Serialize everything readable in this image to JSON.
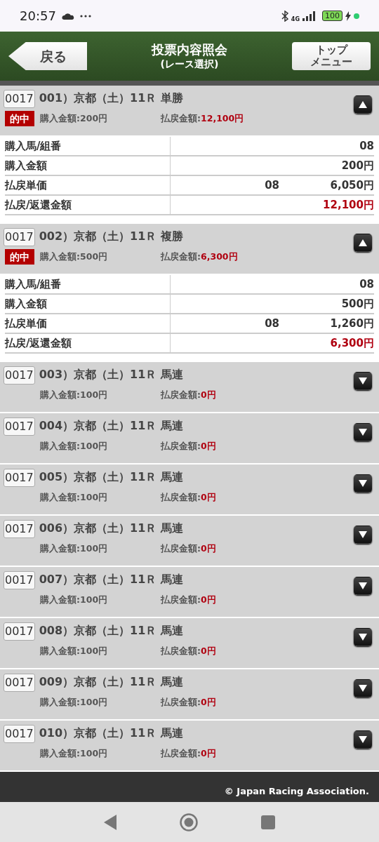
{
  "status_bar": {
    "time": "20:57",
    "network": "4G",
    "battery": "100"
  },
  "header": {
    "back_button": "戻る",
    "title": "投票内容照会",
    "subtitle": "(レース選択)",
    "top_button_lines": [
      "トップ",
      "メニュー"
    ]
  },
  "bets": [
    {
      "ticket": "0017",
      "title": "001）京都（土）11Ｒ 単勝",
      "expanded": true,
      "badge": "的中",
      "purchase_label": "購入金額:",
      "purchase_amount": "200円",
      "payout_label": "払戻金額:",
      "payout_amount": "12,100円",
      "details": [
        {
          "label": "購入馬/組番",
          "value": "08",
          "highlight": false
        },
        {
          "label": "購入金額",
          "value": "200円",
          "highlight": false
        },
        {
          "label": "払戻単価",
          "combo": "08",
          "value": "6,050円",
          "highlight": false
        },
        {
          "label": "払戻/返還金額",
          "value": "12,100円",
          "highlight": true
        }
      ]
    },
    {
      "ticket": "0017",
      "title": "002）京都（土）11Ｒ 複勝",
      "expanded": true,
      "badge": "的中",
      "purchase_label": "購入金額:",
      "purchase_amount": "500円",
      "payout_label": "払戻金額:",
      "payout_amount": "6,300円",
      "details": [
        {
          "label": "購入馬/組番",
          "value": "08",
          "highlight": false
        },
        {
          "label": "購入金額",
          "value": "500円",
          "highlight": false
        },
        {
          "label": "払戻単価",
          "combo": "08",
          "value": "1,260円",
          "highlight": false
        },
        {
          "label": "払戻/返還金額",
          "value": "6,300円",
          "highlight": true
        }
      ]
    },
    {
      "ticket": "0017",
      "title": "003）京都（土）11Ｒ 馬連",
      "expanded": false,
      "purchase_label": "購入金額:",
      "purchase_amount": "100円",
      "payout_label": "払戻金額:",
      "payout_amount": "0円"
    },
    {
      "ticket": "0017",
      "title": "004）京都（土）11Ｒ 馬連",
      "expanded": false,
      "purchase_label": "購入金額:",
      "purchase_amount": "100円",
      "payout_label": "払戻金額:",
      "payout_amount": "0円"
    },
    {
      "ticket": "0017",
      "title": "005）京都（土）11Ｒ 馬連",
      "expanded": false,
      "purchase_label": "購入金額:",
      "purchase_amount": "100円",
      "payout_label": "払戻金額:",
      "payout_amount": "0円"
    },
    {
      "ticket": "0017",
      "title": "006）京都（土）11Ｒ 馬連",
      "expanded": false,
      "purchase_label": "購入金額:",
      "purchase_amount": "100円",
      "payout_label": "払戻金額:",
      "payout_amount": "0円"
    },
    {
      "ticket": "0017",
      "title": "007）京都（土）11Ｒ 馬連",
      "expanded": false,
      "purchase_label": "購入金額:",
      "purchase_amount": "100円",
      "payout_label": "払戻金額:",
      "payout_amount": "0円"
    },
    {
      "ticket": "0017",
      "title": "008）京都（土）11Ｒ 馬連",
      "expanded": false,
      "purchase_label": "購入金額:",
      "purchase_amount": "100円",
      "payout_label": "払戻金額:",
      "payout_amount": "0円"
    },
    {
      "ticket": "0017",
      "title": "009）京都（土）11Ｒ 馬連",
      "expanded": false,
      "purchase_label": "購入金額:",
      "purchase_amount": "100円",
      "payout_label": "払戻金額:",
      "payout_amount": "0円"
    },
    {
      "ticket": "0017",
      "title": "010）京都（土）11Ｒ 馬連",
      "expanded": false,
      "purchase_label": "購入金額:",
      "purchase_amount": "100円",
      "payout_label": "払戻金額:",
      "payout_amount": "0円"
    }
  ],
  "footer": {
    "copyright": "© Japan Racing Association."
  }
}
